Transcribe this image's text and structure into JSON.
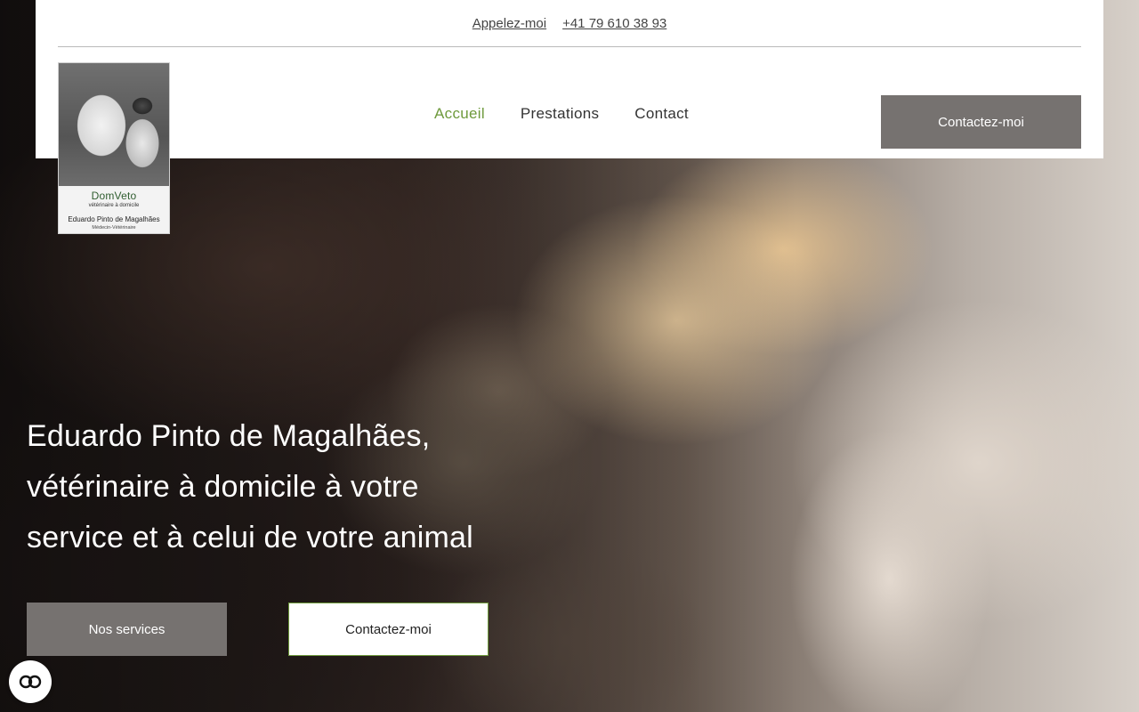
{
  "topbar": {
    "call_label": "Appelez-moi",
    "phone": "+41 79 610 38 93"
  },
  "logo": {
    "brand": "DomVeto",
    "tagline": "vétérinaire à domicile",
    "name": "Eduardo Pinto de Magalhães",
    "role": "Médecin-Vétérinaire"
  },
  "nav": {
    "items": [
      {
        "label": "Accueil",
        "active": true
      },
      {
        "label": "Prestations",
        "active": false
      },
      {
        "label": "Contact",
        "active": false
      }
    ]
  },
  "header_cta": "Contactez-moi",
  "hero": {
    "title_line1": "Eduardo Pinto de Magalhães,",
    "title_line2": "vétérinaire à domicile à votre",
    "title_line3": "service et à celui de votre animal",
    "btn_services": "Nos services",
    "btn_contact": "Contactez-moi"
  },
  "colors": {
    "accent_green": "#6e9a3c",
    "button_gray": "#767270"
  },
  "icons": {
    "accessibility": "accessibility-icon"
  }
}
